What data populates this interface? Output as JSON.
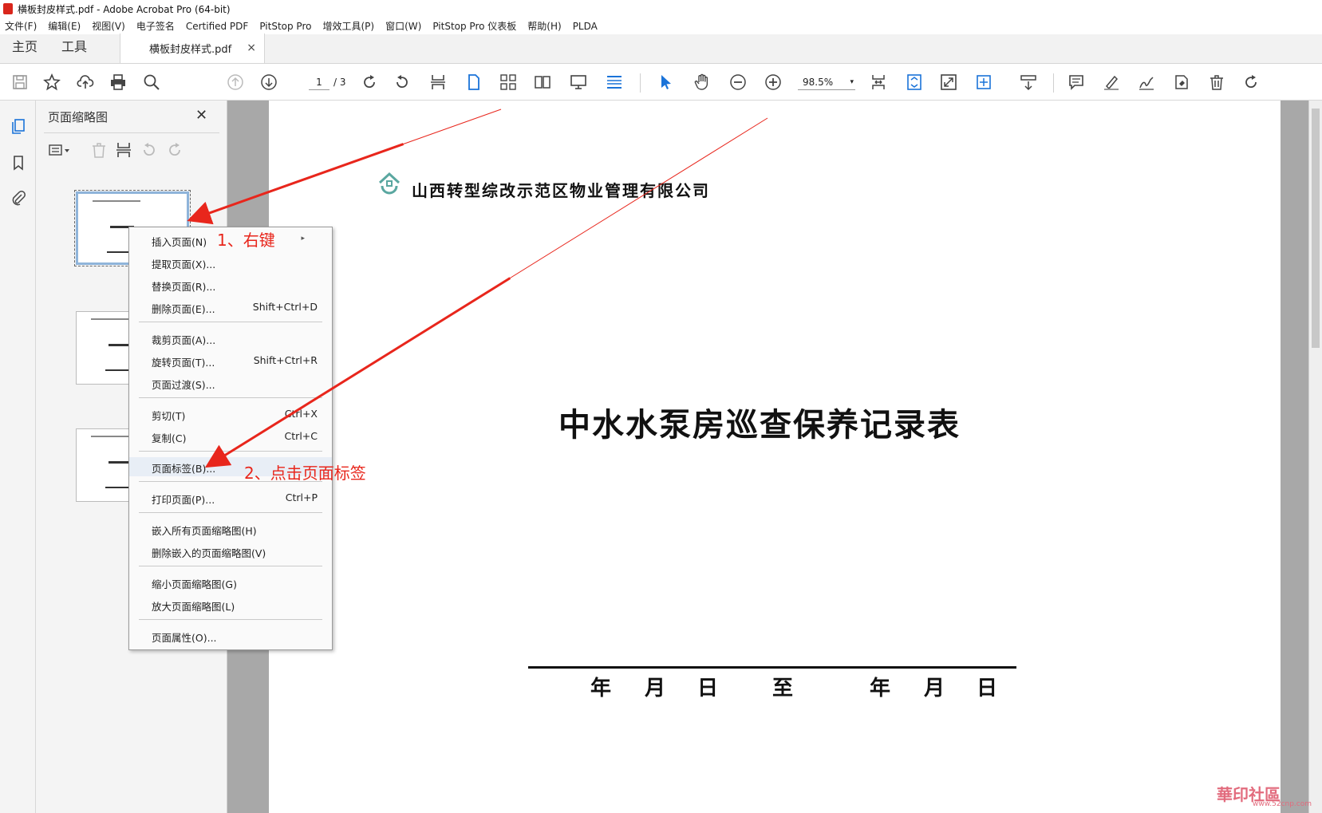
{
  "window": {
    "title": "横板封皮样式.pdf - Adobe Acrobat Pro (64-bit)"
  },
  "menubar": {
    "items": [
      "文件(F)",
      "编辑(E)",
      "视图(V)",
      "电子签名",
      "Certified PDF",
      "PitStop Pro",
      "增效工具(P)",
      "窗口(W)",
      "PitStop Pro 仪表板",
      "帮助(H)",
      "PLDA"
    ]
  },
  "tabs": {
    "home": "主页",
    "tools": "工具",
    "doc": "横板封皮样式.pdf",
    "close": "×"
  },
  "toolbar": {
    "page_current": "1",
    "page_total": "/ 3",
    "zoom": "98.5%",
    "zoom_caret": "▾"
  },
  "panel": {
    "title": "页面缩略图",
    "close": "✕"
  },
  "context_menu": {
    "items": [
      {
        "label": "插入页面(N)",
        "shortcut": "",
        "submenu": "▸"
      },
      {
        "label": "提取页面(X)...",
        "shortcut": ""
      },
      {
        "label": "替换页面(R)...",
        "shortcut": ""
      },
      {
        "label": "删除页面(E)...",
        "shortcut": "Shift+Ctrl+D"
      },
      {
        "label": "裁剪页面(A)...",
        "shortcut": ""
      },
      {
        "label": "旋转页面(T)...",
        "shortcut": "Shift+Ctrl+R"
      },
      {
        "label": "页面过渡(S)...",
        "shortcut": ""
      },
      {
        "label": "剪切(T)",
        "shortcut": "Ctrl+X"
      },
      {
        "label": "复制(C)",
        "shortcut": "Ctrl+C"
      },
      {
        "label": "页面标签(B)...",
        "shortcut": ""
      },
      {
        "label": "打印页面(P)...",
        "shortcut": "Ctrl+P"
      },
      {
        "label": "嵌入所有页面缩略图(H)",
        "shortcut": ""
      },
      {
        "label": "删除嵌入的页面缩略图(V)",
        "shortcut": ""
      },
      {
        "label": "缩小页面缩略图(G)",
        "shortcut": ""
      },
      {
        "label": "放大页面缩略图(L)",
        "shortcut": ""
      },
      {
        "label": "页面属性(O)...",
        "shortcut": ""
      }
    ]
  },
  "annotations": {
    "step1": "1、右键",
    "step2": "2、点击页面标签",
    "color": "#e8261c"
  },
  "document": {
    "company": "山西转型综改示范区物业管理有限公司",
    "title": "中水水泵房巡查保养记录表",
    "date_parts": [
      "年",
      "月",
      "日",
      "至",
      "年",
      "月",
      "日"
    ]
  },
  "watermark": {
    "text": "華印社區",
    "url": "www.52cnp.com"
  }
}
